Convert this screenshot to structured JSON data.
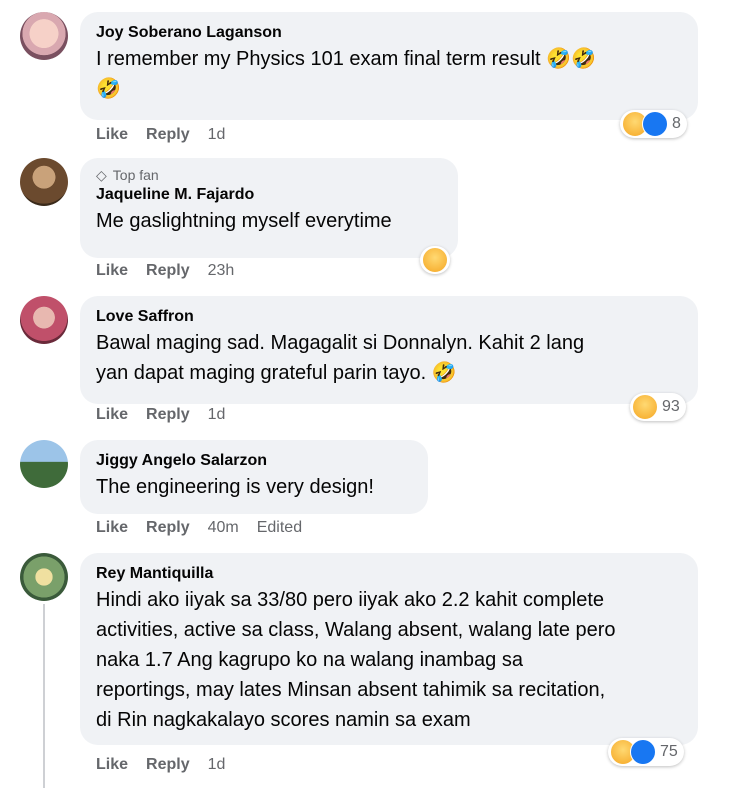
{
  "comments": [
    {
      "name": "Joy Soberano Laganson",
      "lines": [
        "I remember my Physics 101 exam final term result 🤣🤣",
        "🤣"
      ],
      "like": "Like",
      "reply": "Reply",
      "time": "1d",
      "reactions": {
        "icons": [
          "haha",
          "like"
        ],
        "count": "8"
      }
    },
    {
      "badge": "Top fan",
      "name": "Jaqueline M. Fajardo",
      "lines": [
        "Me gaslightning myself everytime"
      ],
      "like": "Like",
      "reply": "Reply",
      "time": "23h",
      "reactions": {
        "icons": [
          "haha"
        ],
        "count": ""
      }
    },
    {
      "name": "Love Saffron",
      "lines": [
        "Bawal maging sad. Magagalit si Donnalyn. Kahit 2 lang",
        "yan dapat maging grateful parin tayo. 🤣"
      ],
      "like": "Like",
      "reply": "Reply",
      "time": "1d",
      "reactions": {
        "icons": [
          "haha"
        ],
        "count": "93"
      }
    },
    {
      "name": "Jiggy Angelo Salarzon",
      "lines": [
        "The engineering is very design!"
      ],
      "like": "Like",
      "reply": "Reply",
      "time": "40m",
      "edited": "Edited"
    },
    {
      "name": "Rey Mantiquilla",
      "lines": [
        "Hindi ako iiyak sa 33/80 pero iiyak ako 2.2 kahit complete",
        "activities, active sa class, Walang absent, walang late pero",
        "naka 1.7 Ang kagrupo ko na walang inambag sa",
        "reportings, may lates Minsan absent tahimik sa recitation,",
        "di Rin nagkakalayo scores namin sa exam"
      ],
      "like": "Like",
      "reply": "Reply",
      "time": "1d",
      "reactions": {
        "icons": [
          "haha",
          "like"
        ],
        "count": "75"
      }
    }
  ],
  "colors": {
    "bubble": "#f0f2f5",
    "meta_text": "#65676b",
    "like_blue": "#1877f2",
    "haha_yellow": "#f7b125"
  }
}
